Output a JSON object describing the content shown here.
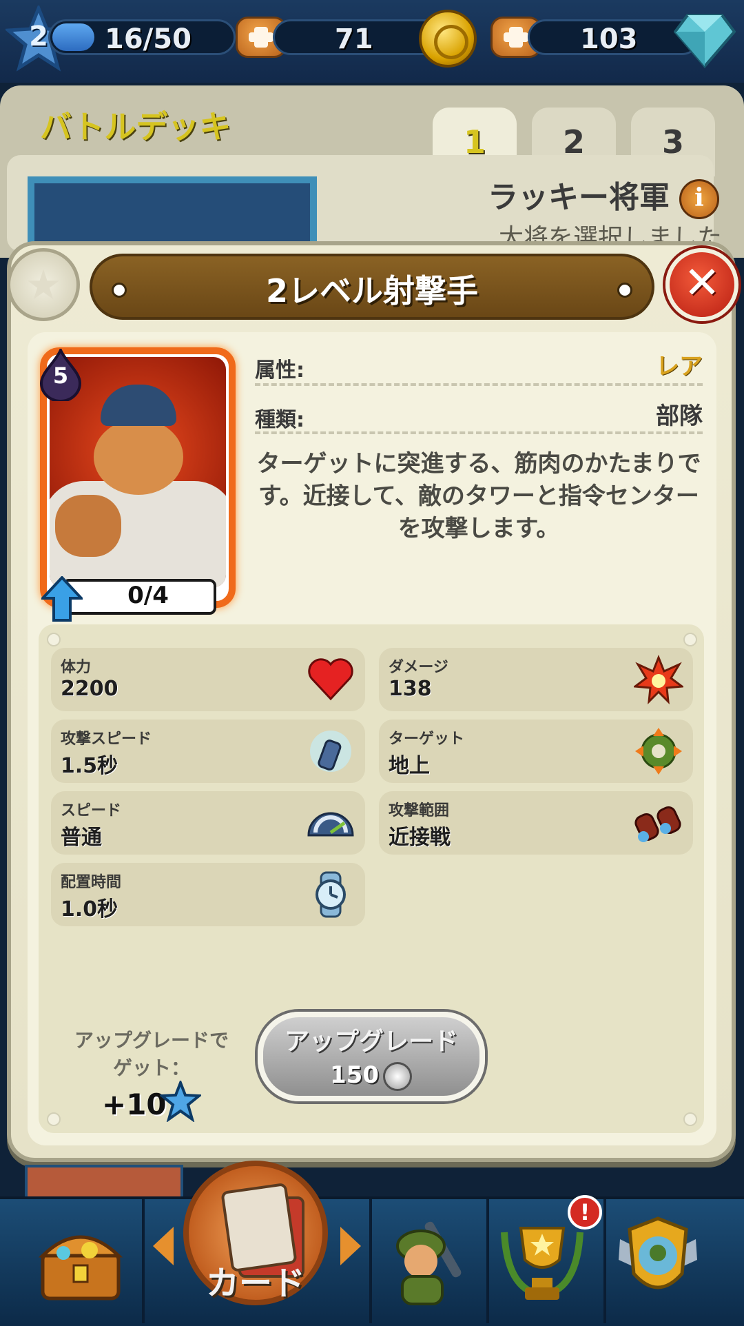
{
  "topbar": {
    "level": "2",
    "xp": "16/50",
    "xp_fraction": 0.32,
    "gold": "71",
    "gems": "103"
  },
  "deck": {
    "title": "バトルデッキ",
    "tabs": [
      "1",
      "2",
      "3"
    ],
    "active_tab": "1",
    "general_name": "ラッキー将軍",
    "general_status": "大将を選択しました"
  },
  "dialog": {
    "title": "2レベル射撃手",
    "card": {
      "cost": "5",
      "progress": "0/4"
    },
    "attributes": [
      {
        "label": "属性:",
        "value": "レア",
        "color": "#d9a21e"
      },
      {
        "label": "種類:",
        "value": "部隊",
        "color": "#3a3a3a"
      }
    ],
    "description": "ターゲットに突進する、筋肉のかたまりです。近接して、敵のタワーと指令センターを攻撃します。",
    "stats": [
      {
        "label": "体力",
        "value": "2200",
        "icon": "heart-icon"
      },
      {
        "label": "ダメージ",
        "value": "138",
        "icon": "explosion-icon"
      },
      {
        "label": "攻撃スピード",
        "value": "1.5秒",
        "icon": "bullet-icon"
      },
      {
        "label": "ターゲット",
        "value": "地上",
        "icon": "target-icon"
      },
      {
        "label": "スピード",
        "value": "普通",
        "icon": "speedometer-icon"
      },
      {
        "label": "攻撃範囲",
        "value": "近接戦",
        "icon": "binoculars-icon"
      },
      {
        "label": "配置時間",
        "value": "1.0秒",
        "icon": "stopwatch-icon"
      }
    ],
    "reward_label": "アップグレードでゲット：",
    "reward_value": "+10",
    "upgrade": {
      "label": "アップグレード",
      "cost": "150"
    }
  },
  "bottomnav": {
    "center_label": "カード",
    "items": [
      "chest-icon",
      "cards-icon",
      "soldier-icon",
      "trophy-icon",
      "clan-shield-icon"
    ],
    "alert": "!"
  }
}
